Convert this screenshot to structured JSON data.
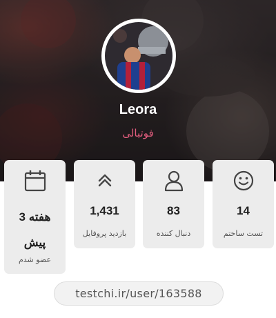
{
  "profile": {
    "name": "Leora",
    "subtitle": "فوتبالی"
  },
  "stats": [
    {
      "value": "3 هفته پیش",
      "label": "عضو شدم",
      "icon": "calendar-icon"
    },
    {
      "value": "1,431",
      "label": "بازدید پروفایل",
      "icon": "double-chevron-up-icon"
    },
    {
      "value": "83",
      "label": "دنبال کننده",
      "icon": "user-icon"
    },
    {
      "value": "14",
      "label": "تست ساختم",
      "icon": "smiley-icon"
    }
  ],
  "profile_url": "testchi.ir/user/163588",
  "colors": {
    "accent": "#e35d7e",
    "card_bg": "#ececec"
  }
}
